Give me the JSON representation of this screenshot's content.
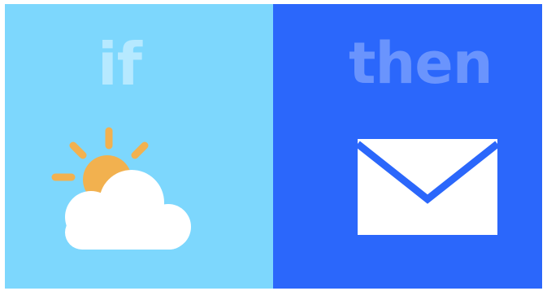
{
  "if_panel": {
    "word": "if",
    "background": "#7dd7fd",
    "word_color": "#b6e9ff",
    "icon": "partly-sunny-icon",
    "sun_color": "#f2b14f",
    "cloud_color": "#ffffff"
  },
  "then_panel": {
    "word": "then",
    "background": "#2b67fb",
    "word_color": "#6a94fd",
    "icon": "envelope-icon",
    "envelope_color": "#ffffff"
  }
}
